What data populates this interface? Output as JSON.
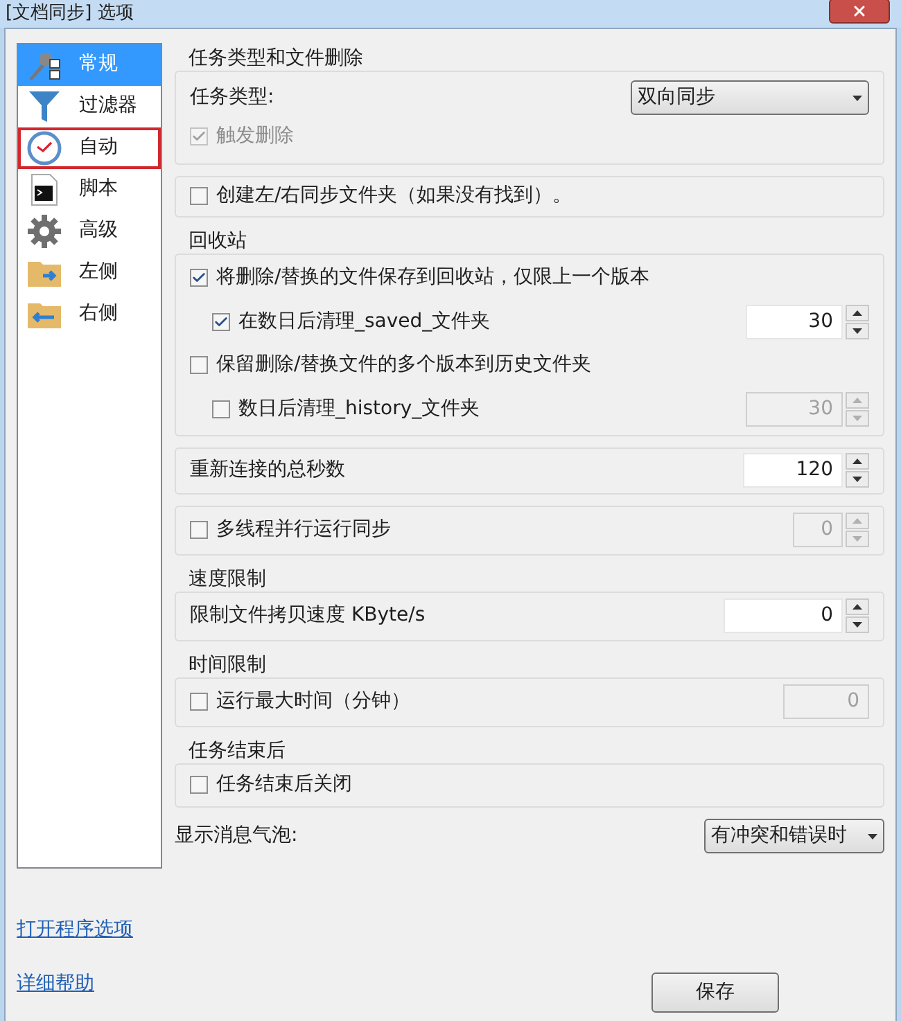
{
  "window": {
    "title": "[文档同步] 选项"
  },
  "sidebar": {
    "items": [
      {
        "label": "常规",
        "selected": true,
        "highlighted": false
      },
      {
        "label": "过滤器",
        "selected": false,
        "highlighted": false
      },
      {
        "label": "自动",
        "selected": false,
        "highlighted": true
      },
      {
        "label": "脚本",
        "selected": false,
        "highlighted": false
      },
      {
        "label": "高级",
        "selected": false,
        "highlighted": false
      },
      {
        "label": "左侧",
        "selected": false,
        "highlighted": false
      },
      {
        "label": "右侧",
        "selected": false,
        "highlighted": false
      }
    ]
  },
  "task_group": {
    "title": "任务类型和文件删除",
    "task_type_label": "任务类型:",
    "task_type_value": "双向同步",
    "trigger_delete": {
      "label": "触发删除",
      "checked": true,
      "disabled": true
    }
  },
  "create_folders": {
    "label": "创建左/右同步文件夹（如果没有找到）。",
    "checked": false
  },
  "recycle": {
    "title": "回收站",
    "rows": [
      {
        "label": "将删除/替换的文件保存到回收站，仅限上一个版本",
        "checked": true,
        "children": [
          {
            "label": "在数日后清理_saved_文件夹",
            "checked": true,
            "value": "30",
            "disabled": false
          }
        ]
      },
      {
        "label": "保留删除/替换文件的多个版本到历史文件夹",
        "checked": false,
        "children": [
          {
            "label": "数日后清理_history_文件夹",
            "checked": false,
            "value": "30",
            "disabled": true
          }
        ]
      }
    ]
  },
  "reconnect": {
    "label": "重新连接的总秒数",
    "value": "120"
  },
  "multithread": {
    "label": "多线程并行运行同步",
    "checked": false,
    "value": "0",
    "disabled": true
  },
  "speed": {
    "title": "速度限制",
    "label": "限制文件拷贝速度 KByte/s",
    "value": "0"
  },
  "time": {
    "title": "时间限制",
    "label": "运行最大时间（分钟）",
    "checked": false,
    "value": "0",
    "disabled": true
  },
  "finish": {
    "title": "任务结束后",
    "label": "任务结束后关闭",
    "checked": false
  },
  "bubble": {
    "label": "显示消息气泡:",
    "value": "有冲突和错误时"
  },
  "links": [
    "打开程序选项",
    "详细帮助"
  ],
  "buttons": [
    "保存"
  ]
}
